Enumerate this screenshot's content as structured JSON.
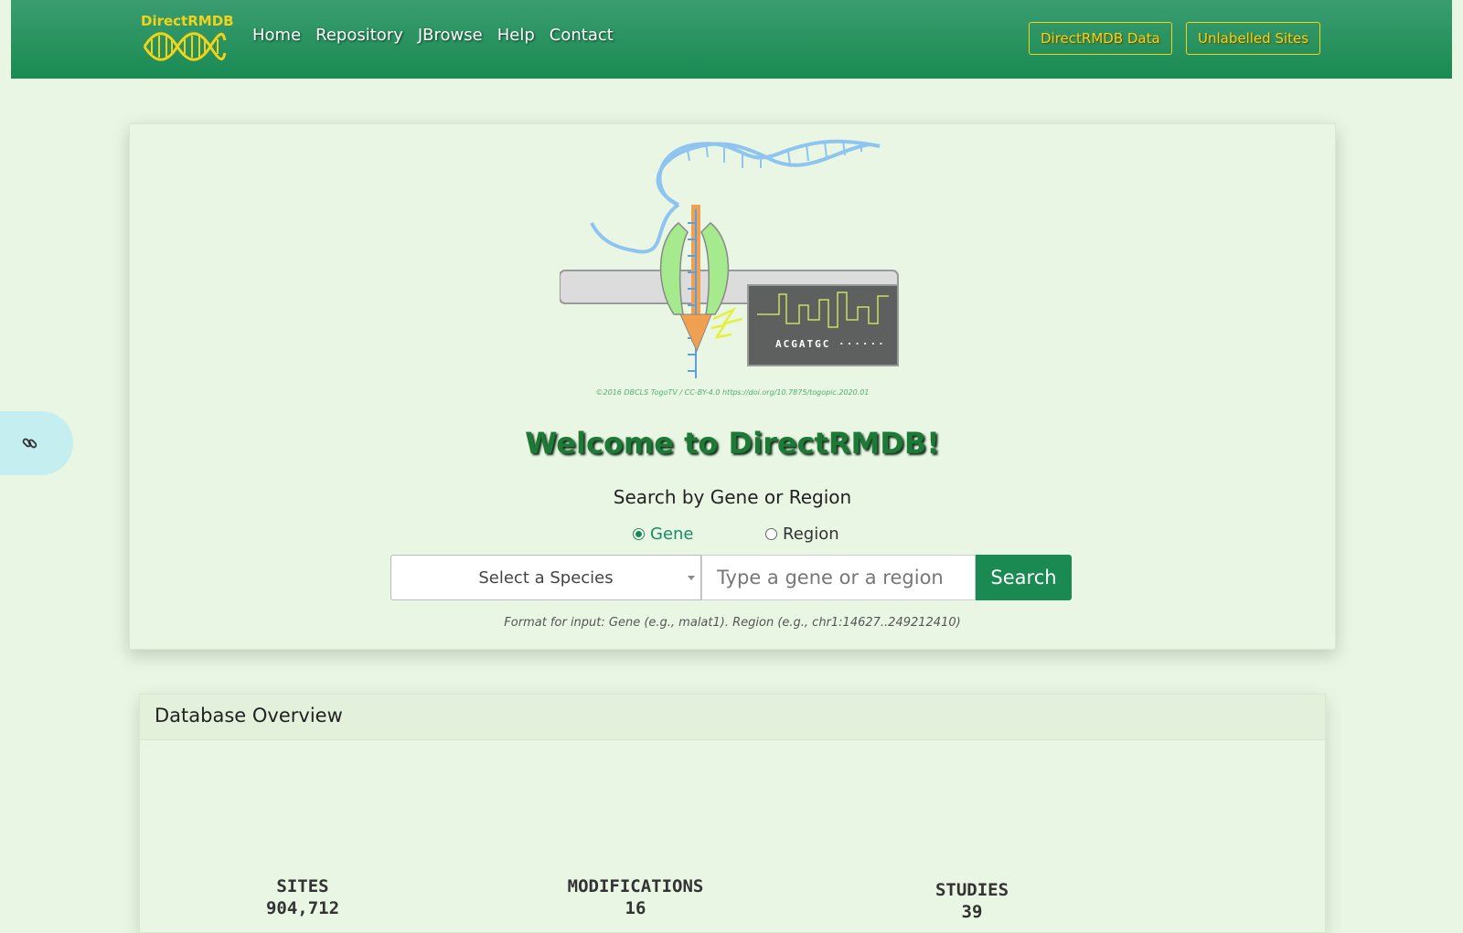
{
  "navbar": {
    "logo_text": "DirectRMDB",
    "links": [
      "Home",
      "Repository",
      "JBrowse",
      "Help",
      "Contact"
    ],
    "buttons": [
      "DirectRMDB Data",
      "Unlabelled Sites"
    ]
  },
  "hero": {
    "credit": "©2016 DBCLS TogoTV / CC-BY-4.0 https://doi.org/10.7875/togopic.2020.01",
    "sequence_text": "ACGATGC ······",
    "welcome": "Welcome to DirectRMDB!",
    "search_title": "Search by Gene or Region",
    "radio_gene": "Gene",
    "radio_region": "Region",
    "selected_radio": "Gene",
    "species_select": "Select a Species",
    "input_placeholder": "Type a gene or a region",
    "search_button": "Search",
    "format_hint": "Format for input: Gene (e.g., malat1). Region (e.g., chr1:14627..249212410)"
  },
  "overview": {
    "title": "Database Overview",
    "stats": [
      {
        "label": "SITES",
        "value": "904,712"
      },
      {
        "label": "MODIFICATIONS",
        "value": "16"
      },
      {
        "label": "STUDIES",
        "value": "39"
      }
    ]
  },
  "colors": {
    "nav_green": "#1a8a52",
    "logo_yellow": "#f2d21a",
    "page_bg": "#e9f6e3",
    "side_tab": "#c4eef0"
  },
  "icons": [
    "dna-logo-icon",
    "link-icon"
  ]
}
